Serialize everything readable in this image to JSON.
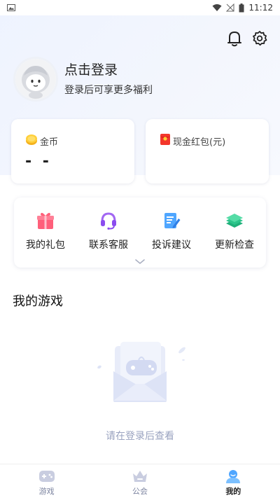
{
  "status_bar": {
    "time": "11:12"
  },
  "top_icons": [
    "bell-icon",
    "gear-icon"
  ],
  "profile": {
    "title": "点击登录",
    "subtitle": "登录后可享更多福利"
  },
  "cards": {
    "coin": {
      "label": "金币",
      "value": "- -"
    },
    "cash": {
      "label": "现金红包(元)"
    }
  },
  "tools": [
    {
      "label": "我的礼包",
      "icon": "gift-icon"
    },
    {
      "label": "联系客服",
      "icon": "headset-icon"
    },
    {
      "label": "投诉建议",
      "icon": "feedback-icon"
    },
    {
      "label": "更新检查",
      "icon": "layers-icon"
    }
  ],
  "my_games": {
    "title": "我的游戏",
    "empty_text": "请在登录后查看"
  },
  "bottom_nav": [
    {
      "label": "游戏",
      "icon": "gamepad-icon",
      "active": false
    },
    {
      "label": "公会",
      "icon": "guild-icon",
      "active": false
    },
    {
      "label": "我的",
      "icon": "user-icon",
      "active": true
    }
  ],
  "colors": {
    "accent": "#4fa6ff",
    "muted_text": "#9aa3c0",
    "nav_inactive": "#7c84a0"
  }
}
